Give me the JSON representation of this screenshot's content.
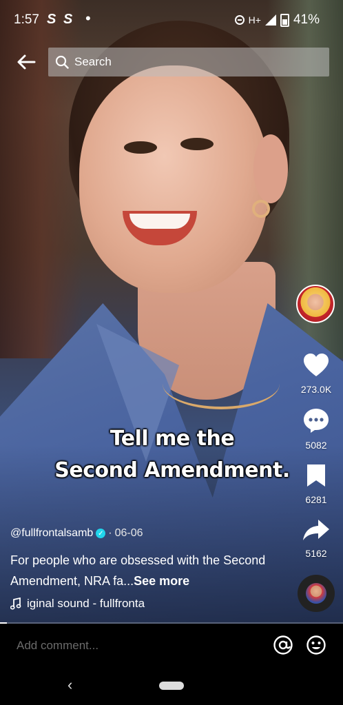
{
  "status_bar": {
    "time": "1:57",
    "app_icons": [
      "S",
      "S"
    ],
    "network": "H+",
    "battery": "41%"
  },
  "top_bar": {
    "search_placeholder": "Search"
  },
  "right_rail": {
    "likes": "273.0K",
    "comments": "5082",
    "saves": "6281",
    "shares": "5162"
  },
  "video": {
    "caption_line1": "Tell me the",
    "caption_line2": "Second Amendment."
  },
  "post": {
    "author": "@fullfrontalsamb",
    "date_separator": "·",
    "date": "06-06",
    "description": "For people who are obsessed with the Second Amendment, NRA fa...",
    "see_more": "See more",
    "sound": "iginal sound - fullfronta",
    "progress": 0.02
  },
  "comment_bar": {
    "placeholder": "Add comment..."
  },
  "colors": {
    "verified": "#20d5ec",
    "like": "#ffffff"
  }
}
